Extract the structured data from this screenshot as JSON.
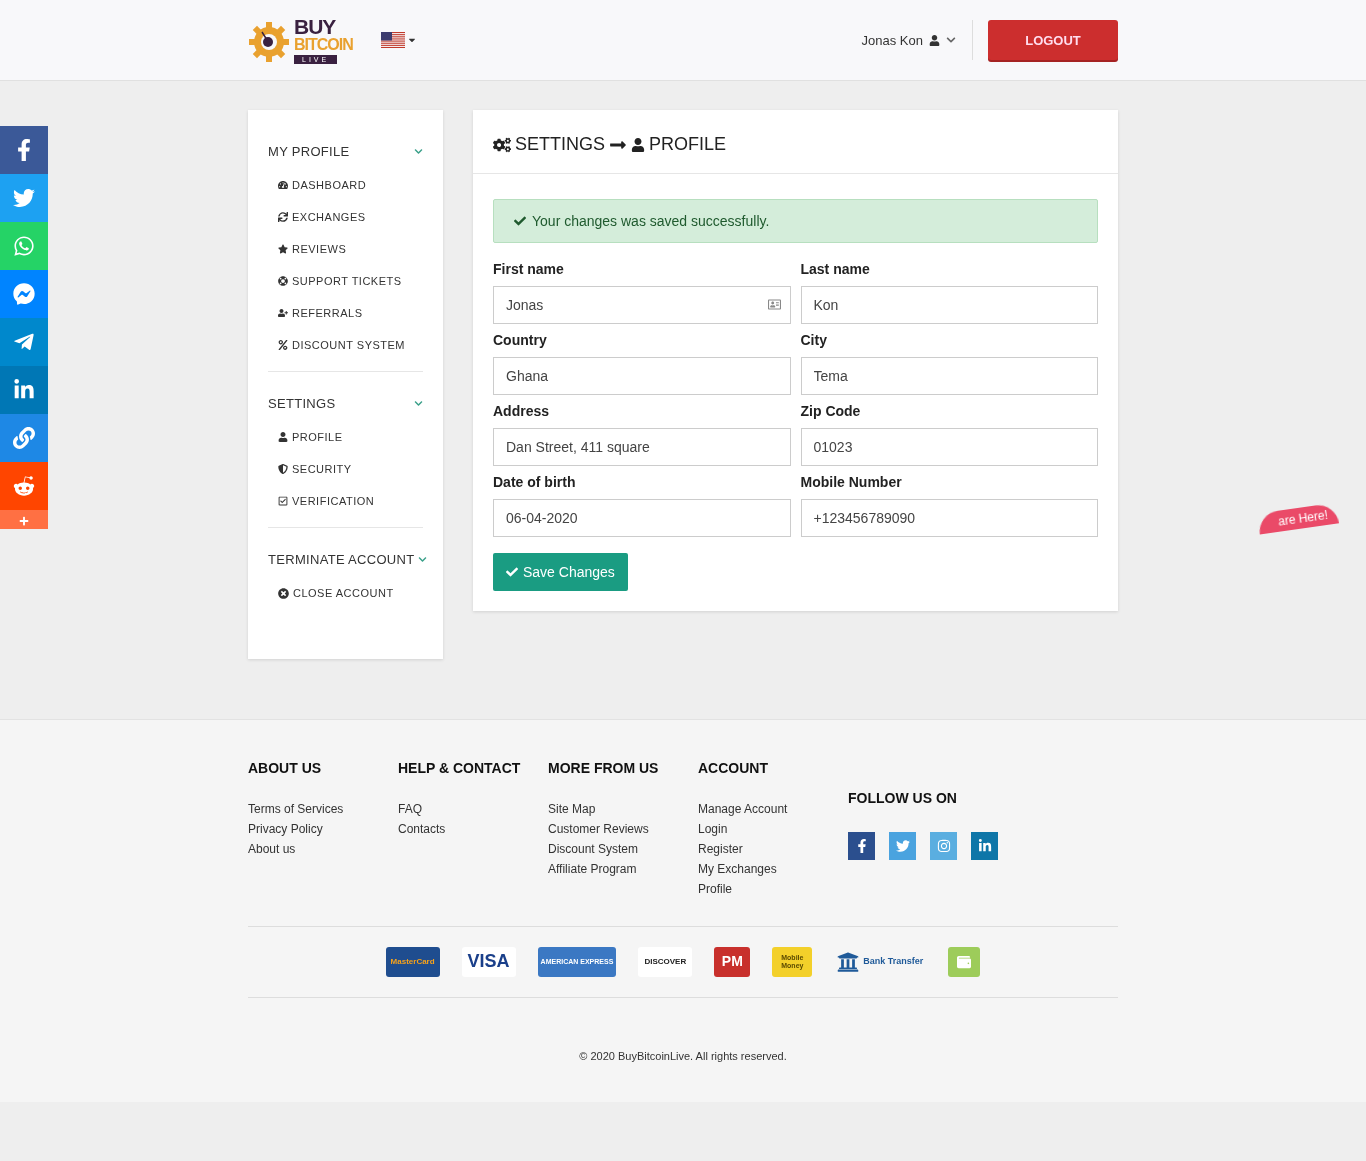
{
  "header": {
    "logo": {
      "top": "BUY",
      "middle": "BITCOIN",
      "bottom": "LIVE"
    },
    "user_name": "Jonas Kon",
    "logout": "LOGOUT"
  },
  "social": [
    {
      "kind": "facebook",
      "color": "#3b5998"
    },
    {
      "kind": "twitter",
      "color": "#1da1f2"
    },
    {
      "kind": "whatsapp",
      "color": "#25d366"
    },
    {
      "kind": "messenger",
      "color": "#0084ff"
    },
    {
      "kind": "telegram",
      "color": "#0088cc"
    },
    {
      "kind": "linkedin",
      "color": "#0077b5"
    },
    {
      "kind": "link",
      "color": "#1e88e5"
    },
    {
      "kind": "reddit",
      "color": "#ff4500"
    },
    {
      "kind": "more",
      "color": "#ff7043"
    }
  ],
  "sidebar": {
    "sections": [
      {
        "title": "MY PROFILE",
        "items": [
          {
            "kind": "dashboard",
            "label": "DASHBOARD"
          },
          {
            "kind": "exchange",
            "label": "EXCHANGES"
          },
          {
            "kind": "star",
            "label": "REVIEWS"
          },
          {
            "kind": "support",
            "label": "SUPPORT TICKETS"
          },
          {
            "kind": "referral",
            "label": "REFERRALS"
          },
          {
            "kind": "percent",
            "label": "DISCOUNT SYSTEM"
          }
        ]
      },
      {
        "title": "SETTINGS",
        "items": [
          {
            "kind": "user",
            "label": "PROFILE"
          },
          {
            "kind": "shield",
            "label": "SECURITY"
          },
          {
            "kind": "check",
            "label": "VERIFICATION"
          }
        ]
      },
      {
        "title": "TERMINATE ACCOUNT",
        "items": [
          {
            "kind": "close",
            "label": "CLOSE ACCOUNT"
          }
        ]
      }
    ]
  },
  "panel": {
    "title_left": "SETTINGS",
    "title_right": "PROFILE",
    "alert": "Your changes was saved successfully.",
    "fields": [
      {
        "label": "First name",
        "value": "Jonas",
        "autofill": true
      },
      {
        "label": "Last name",
        "value": "Kon",
        "autofill": false
      },
      {
        "label": "Country",
        "value": "Ghana",
        "autofill": false
      },
      {
        "label": "City",
        "value": "Tema",
        "autofill": false
      },
      {
        "label": "Address",
        "value": "Dan Street, 411 square",
        "autofill": false
      },
      {
        "label": "Zip Code",
        "value": "01023",
        "autofill": false
      },
      {
        "label": "Date of birth",
        "value": "06-04-2020",
        "autofill": false
      },
      {
        "label": "Mobile Number",
        "value": "+123456789090",
        "autofill": false
      }
    ],
    "save": "Save Changes"
  },
  "badge": "are Here!",
  "footer": {
    "columns": [
      {
        "title": "ABOUT US",
        "links": [
          "Terms of Services",
          "Privacy Policy",
          "About us"
        ]
      },
      {
        "title": "HELP & CONTACT",
        "links": [
          "FAQ",
          "Contacts"
        ]
      },
      {
        "title": "MORE FROM US",
        "links": [
          "Site Map",
          "Customer Reviews",
          "Discount System",
          "Affiliate Program"
        ]
      },
      {
        "title": "ACCOUNT",
        "links": [
          "Manage Account",
          "Login",
          "Register",
          "My Exchanges",
          "Profile"
        ]
      }
    ],
    "follow": {
      "title": "FOLLOW US ON",
      "icons": [
        {
          "kind": "facebook",
          "color": "#2b4f8e"
        },
        {
          "kind": "twitter",
          "color": "#4aa3df"
        },
        {
          "kind": "instagram",
          "color": "#5aaee0"
        },
        {
          "kind": "linkedin",
          "color": "#0e76a8"
        }
      ]
    },
    "payments": [
      {
        "kind": "mastercard",
        "label": "MasterCard"
      },
      {
        "kind": "visa",
        "label": "VISA"
      },
      {
        "kind": "amex",
        "label": "AMERICAN EXPRESS"
      },
      {
        "kind": "discover",
        "label": "DISCOVER"
      },
      {
        "kind": "pm",
        "label": "PM"
      },
      {
        "kind": "money",
        "label": "Mobile Money"
      },
      {
        "kind": "bank",
        "label": "Bank Transfer"
      },
      {
        "kind": "wallet"
      }
    ],
    "copyright": "© 2020 BuyBitcoinLive. All rights reserved."
  }
}
